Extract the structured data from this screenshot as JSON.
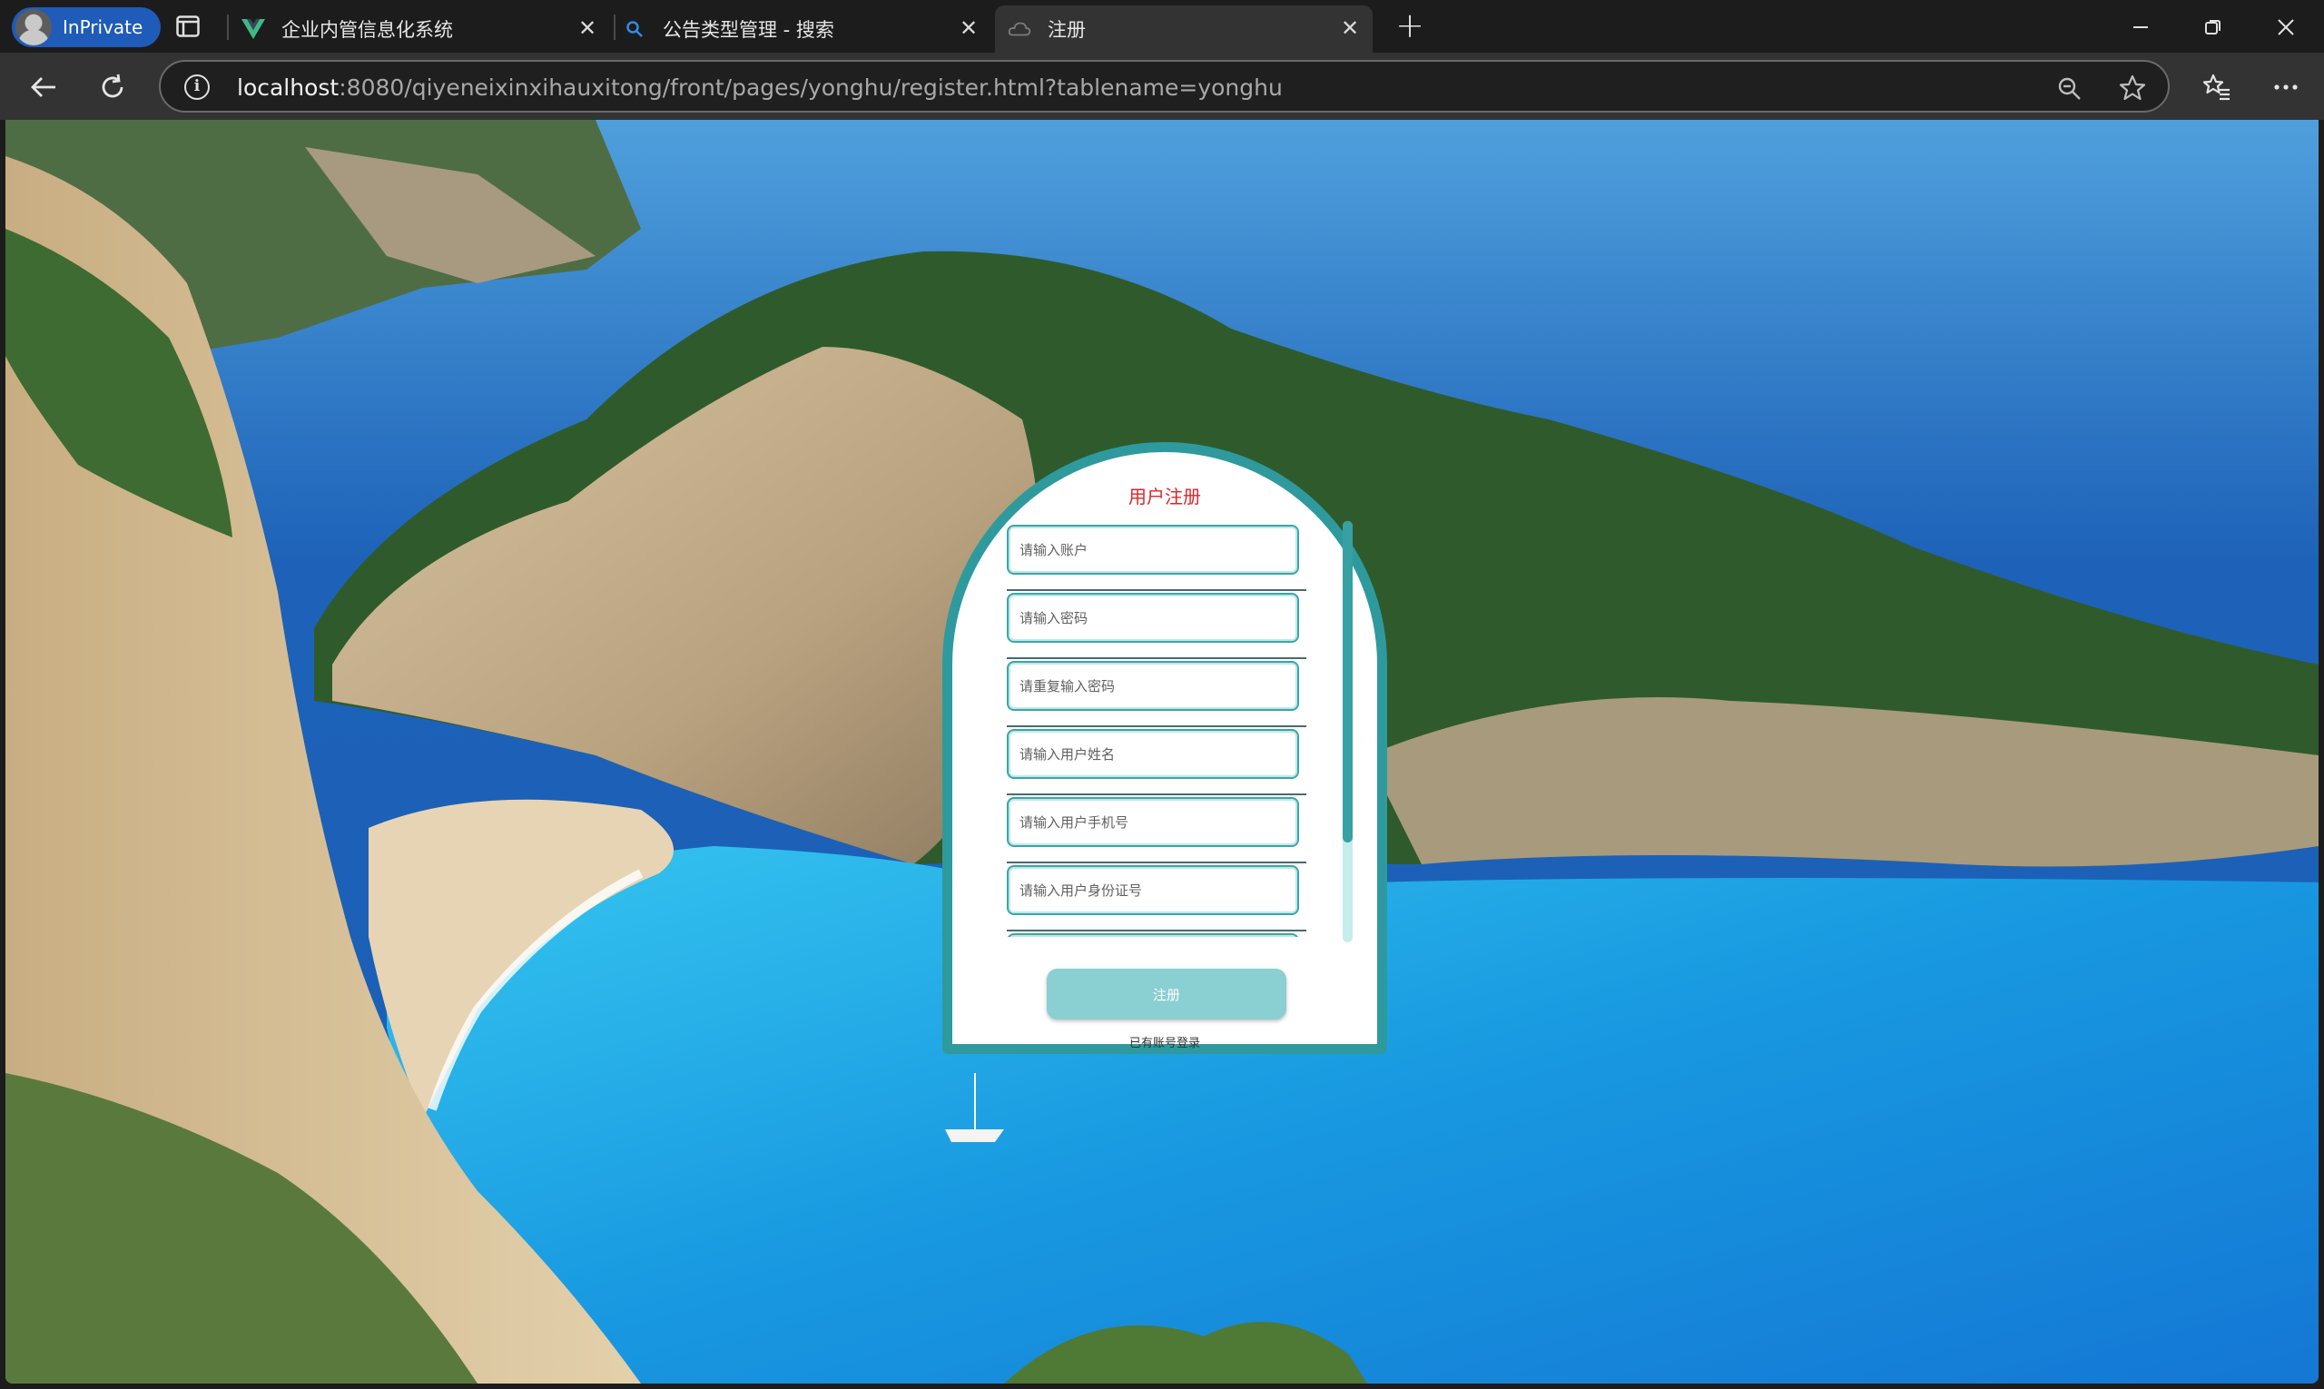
{
  "browser": {
    "inprivate_label": "InPrivate",
    "tabs": [
      {
        "title": "企业内管信息化系统",
        "favicon": "vue-v-icon"
      },
      {
        "title": "公告类型管理 - 搜索",
        "favicon": "search-icon"
      },
      {
        "title": "注册",
        "favicon": "cloud-icon",
        "active": true
      }
    ],
    "url_host": "localhost",
    "url_rest": ":8080/qiyeneixinxihauxitong/front/pages/yonghu/register.html?tablename=yonghu"
  },
  "register": {
    "title": "用户注册",
    "fields": [
      {
        "placeholder": "请输入账户"
      },
      {
        "placeholder": "请输入密码"
      },
      {
        "placeholder": "请重复输入密码"
      },
      {
        "placeholder": "请输入用户姓名"
      },
      {
        "placeholder": "请输入用户手机号"
      },
      {
        "placeholder": "请输入用户身份证号"
      },
      {
        "placeholder": ""
      }
    ],
    "submit_label": "注册",
    "login_link": "已有账号登录"
  },
  "colors": {
    "accent": "#2e9a9e",
    "title_red": "#d9262b",
    "button": "#8acfd2",
    "chrome_bg": "#1c1c1c",
    "inprivate": "#1f5bb8"
  }
}
